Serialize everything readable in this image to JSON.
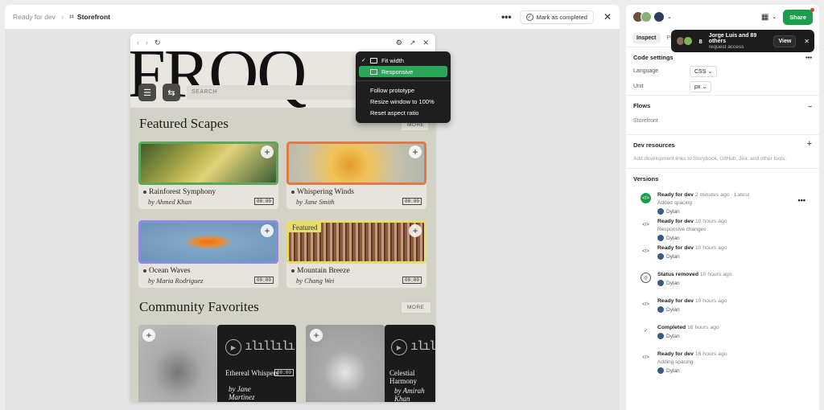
{
  "topbar": {
    "crumb_parent": "Ready for dev",
    "crumb_current": "Storefront",
    "more": "•••",
    "mark_label": "Mark as completed",
    "close": "✕"
  },
  "proto": {
    "hero_text": "FROQ",
    "search_placeholder": "SEARCH",
    "featured_title": "Featured Scapes",
    "more_partial": "MORE",
    "community_title": "Community Favorites",
    "more_label": "MORE",
    "cards": [
      {
        "title": "Rainforest Symphony",
        "artist": "by Ahmed Khan",
        "time": "00:00"
      },
      {
        "title": "Whispering Winds",
        "artist": "by Jane Smith",
        "time": "00:00"
      },
      {
        "title": "Ocean Waves",
        "artist": "by Maria Rodriguez",
        "time": "00:00"
      },
      {
        "title": "Mountain Breeze",
        "artist": "by Chang Wei",
        "time": "00:00",
        "tag": "Featured"
      }
    ],
    "community": [
      {
        "title": "Ethereal Whispers",
        "artist": "by Jane Martinez",
        "time": "00:00"
      },
      {
        "title": "Celestial Harmony",
        "artist": "by Amirah Khan"
      }
    ]
  },
  "menu": {
    "items": [
      "Fit width",
      "Responsive",
      "Follow prototype",
      "Resize window to 100%",
      "Reset aspect ratio"
    ]
  },
  "panel": {
    "share": "Share",
    "tab_inspect": "Inspect",
    "tab_plugins": "Plu",
    "toast": {
      "count": "8",
      "title": "Jorge Luis and 89 others",
      "subtitle": "request access",
      "view": "View",
      "close": "✕"
    },
    "code_settings": "Code settings",
    "language_label": "Language",
    "language_value": "CSS",
    "unit_label": "Unit",
    "unit_value": "px",
    "flows": "Flows",
    "flow_item": "Storefront",
    "dev_resources": "Dev resources",
    "dev_resources_desc": "Add development links to Storybook, GitHub, Jira, and other tools.",
    "versions": "Versions",
    "more": "•••",
    "version_list": [
      {
        "title": "Ready for dev",
        "time": "2 minutes ago · Latest",
        "desc": "Added spacing",
        "user": "Dylan"
      },
      {
        "title": "Ready for dev",
        "time": "10 hours ago",
        "desc": "Responsive changes",
        "user": "Dylan"
      },
      {
        "title": "Ready for dev",
        "time": "10 hours ago",
        "desc": "",
        "user": "Dylan"
      },
      {
        "title": "Status removed",
        "time": "10 hours ago",
        "desc": "",
        "user": "Dylan"
      },
      {
        "title": "Ready for dev",
        "time": "10 hours ago",
        "desc": "",
        "user": "Dylan"
      },
      {
        "title": "Completed",
        "time": "16 hours ago",
        "desc": "",
        "user": "Dylan"
      },
      {
        "title": "Ready for dev",
        "time": "16 hours ago",
        "desc": "Adding spacing",
        "user": "Dylan"
      }
    ]
  },
  "colors": {
    "accent": "#1a9e4c",
    "menu_bg": "#1e1e1e",
    "site_bg": "#d3d2c6"
  }
}
